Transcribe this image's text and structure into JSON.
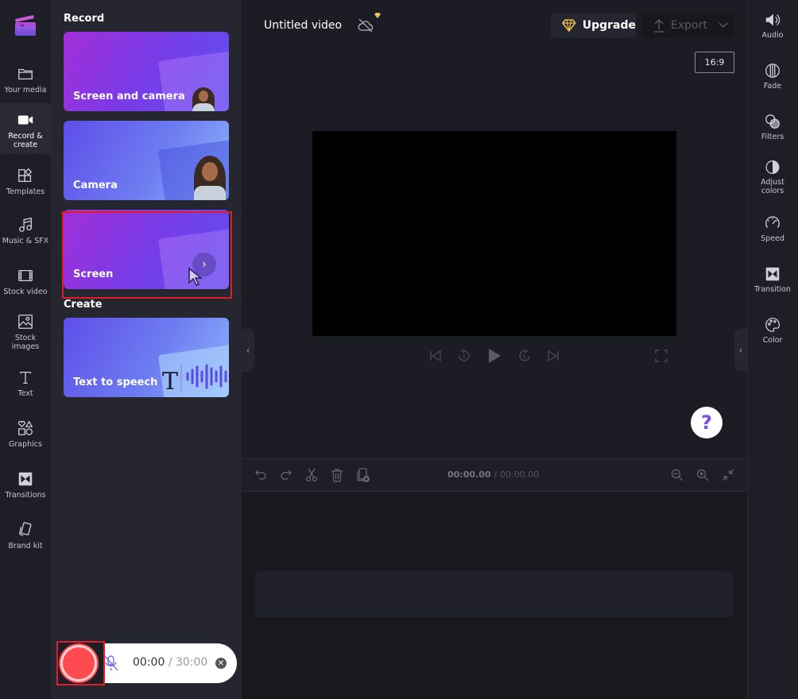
{
  "app": {
    "project_title": "Untitled video",
    "upgrade_label": "Upgrade",
    "export_label": "Export",
    "aspect_ratio": "16:9"
  },
  "left_nav": {
    "items": [
      {
        "id": "your-media",
        "label": "Your media",
        "icon": "folder-icon",
        "active": false
      },
      {
        "id": "record-create",
        "label": "Record &\ncreate",
        "icon": "video-camera-icon",
        "active": true
      },
      {
        "id": "templates",
        "label": "Templates",
        "icon": "templates-icon",
        "active": false
      },
      {
        "id": "music-sfx",
        "label": "Music & SFX",
        "icon": "music-note-icon",
        "active": false
      },
      {
        "id": "stock-video",
        "label": "Stock video",
        "icon": "film-icon",
        "active": false
      },
      {
        "id": "stock-images",
        "label": "Stock\nimages",
        "icon": "image-icon",
        "active": false
      },
      {
        "id": "text",
        "label": "Text",
        "icon": "text-icon",
        "active": false
      },
      {
        "id": "graphics",
        "label": "Graphics",
        "icon": "shapes-icon",
        "active": false
      },
      {
        "id": "transitions",
        "label": "Transitions",
        "icon": "transition-icon",
        "active": false
      },
      {
        "id": "brand-kit",
        "label": "Brand kit",
        "icon": "brand-kit-icon",
        "active": false
      }
    ]
  },
  "panel": {
    "record_title": "Record",
    "create_title": "Create",
    "record_cards": [
      {
        "label": "Screen and camera"
      },
      {
        "label": "Camera"
      },
      {
        "label": "Screen",
        "highlighted": true
      }
    ],
    "create_cards": [
      {
        "label": "Text to speech"
      }
    ]
  },
  "recorder": {
    "elapsed": "00:00",
    "separator": "/",
    "max": "30:00",
    "mic_muted": true
  },
  "timeline": {
    "current_time": "00:00.00",
    "separator": "/",
    "total_time": "00:00.00"
  },
  "right_nav": {
    "items": [
      {
        "id": "audio",
        "label": "Audio",
        "icon": "speaker-icon"
      },
      {
        "id": "fade",
        "label": "Fade",
        "icon": "fade-icon"
      },
      {
        "id": "filters",
        "label": "Filters",
        "icon": "filters-icon"
      },
      {
        "id": "adjust-colors",
        "label": "Adjust\ncolors",
        "icon": "contrast-icon"
      },
      {
        "id": "speed",
        "label": "Speed",
        "icon": "speedometer-icon"
      },
      {
        "id": "transition",
        "label": "Transition",
        "icon": "transition-icon"
      },
      {
        "id": "color",
        "label": "Color",
        "icon": "palette-icon"
      }
    ]
  },
  "colors": {
    "accent_purple": "#7b4fe0",
    "record_red": "#ff4b4f",
    "highlight_red": "#e01e2a",
    "premium_gold": "#f0c050"
  }
}
